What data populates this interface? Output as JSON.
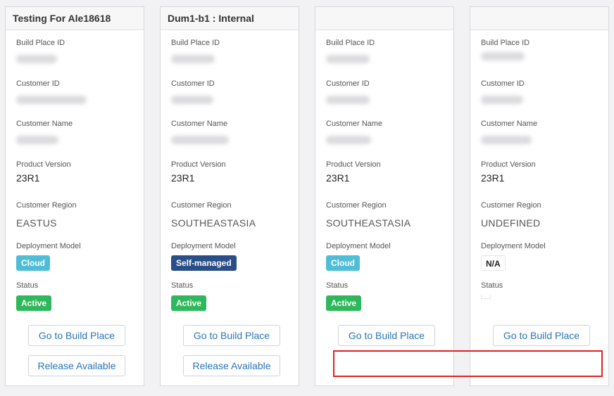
{
  "labels": {
    "build_place_id": "Build Place ID",
    "customer_id": "Customer ID",
    "customer_name": "Customer Name",
    "product_version": "Product Version",
    "customer_region": "Customer Region",
    "deployment_model": "Deployment Model",
    "status": "Status"
  },
  "buttons": {
    "go_to_build_place": "Go to Build Place",
    "release_available": "Release Available"
  },
  "cards": [
    {
      "title": "Testing For Ale18618",
      "product_version": "23R1",
      "customer_region": "EASTUS",
      "deployment_model": "Cloud",
      "status": "Active"
    },
    {
      "title": "Dum1-b1 : Internal",
      "product_version": "23R1",
      "customer_region": "SOUTHEASTASIA",
      "deployment_model": "Self-managed",
      "status": "Active"
    },
    {
      "title": "",
      "product_version": "23R1",
      "customer_region": "SOUTHEASTASIA",
      "deployment_model": "Cloud",
      "status": "Active"
    },
    {
      "title": "",
      "product_version": "23R1",
      "customer_region": "UNDEFINED",
      "deployment_model": "N/A",
      "status": ""
    }
  ]
}
